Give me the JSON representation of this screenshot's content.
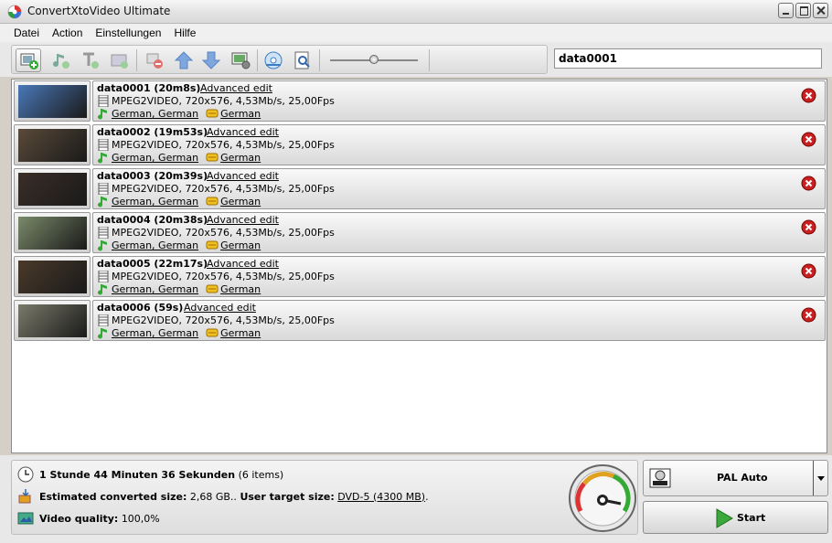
{
  "window": {
    "title": "ConvertXtoVideo Ultimate"
  },
  "menu": [
    "Datei",
    "Action",
    "Einstellungen",
    "Hilfe"
  ],
  "toolbar": {
    "icons": [
      "add-file-icon",
      "add-audio-icon",
      "add-subtitle-icon",
      "add-chapter-icon",
      "remove-icon",
      "move-up-icon",
      "move-down-icon",
      "settings-icon",
      "burn-disc-icon",
      "preview-icon"
    ],
    "quality_slider": 0.5,
    "search_value": "data0001"
  },
  "files": [
    {
      "name": "data0001 (20m8s)",
      "advanced": "Advanced edit",
      "video": "MPEG2VIDEO, 720x576, 4,53Mb/s, 25,00Fps",
      "audio": "German, German",
      "subtitle": "German",
      "thumb": "#4a78b8"
    },
    {
      "name": "data0002 (19m53s)",
      "advanced": "Advanced edit",
      "video": "MPEG2VIDEO, 720x576, 4,53Mb/s, 25,00Fps",
      "audio": "German, German",
      "subtitle": "German",
      "thumb": "#5a4a3a"
    },
    {
      "name": "data0003 (20m39s)",
      "advanced": "Advanced edit",
      "video": "MPEG2VIDEO, 720x576, 4,53Mb/s, 25,00Fps",
      "audio": "German, German",
      "subtitle": "German",
      "thumb": "#3a2e28"
    },
    {
      "name": "data0004 (20m38s)",
      "advanced": "Advanced edit",
      "video": "MPEG2VIDEO, 720x576, 4,53Mb/s, 25,00Fps",
      "audio": "German, German",
      "subtitle": "German",
      "thumb": "#7a8a6a"
    },
    {
      "name": "data0005 (22m17s)",
      "advanced": "Advanced edit",
      "video": "MPEG2VIDEO, 720x576, 4,53Mb/s, 25,00Fps",
      "audio": "German, German",
      "subtitle": "German",
      "thumb": "#4a3a2a"
    },
    {
      "name": "data0006 (59s)",
      "advanced": "Advanced edit",
      "video": "MPEG2VIDEO, 720x576, 4,53Mb/s, 25,00Fps",
      "audio": "German, German",
      "subtitle": "German",
      "thumb": "#7a7a6a"
    }
  ],
  "status": {
    "duration": "1 Stunde 44 Minuten 36 Sekunden",
    "items": "(6 items)",
    "est_label": "Estimated converted size:",
    "est_value": "2,68 GB..",
    "target_label": "User target size:",
    "target_value": "DVD-5 (4300 MB)",
    "target_suffix": ".",
    "quality_label": "Video quality:",
    "quality_value": "100,0%"
  },
  "preset": {
    "label": "PAL Auto"
  },
  "start": {
    "label": "Start"
  }
}
